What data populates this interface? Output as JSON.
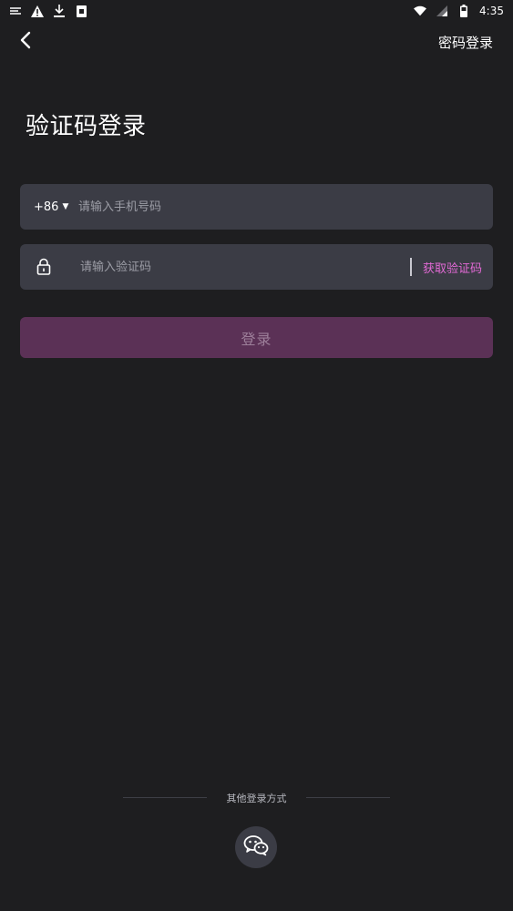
{
  "status_bar": {
    "time": "4:35",
    "left_icons": [
      "message-icon",
      "warning-icon",
      "download-icon",
      "app-notification-icon"
    ],
    "right_icons": [
      "wifi-icon",
      "signal-icon",
      "battery-icon"
    ]
  },
  "header": {
    "back_icon": "chevron-left-icon",
    "password_login_label": "密码登录"
  },
  "title": "验证码登录",
  "phone": {
    "country_code": "+86",
    "placeholder": "请输入手机号码"
  },
  "code": {
    "lock_icon": "lock-icon",
    "placeholder": "请输入验证码",
    "get_code_label": "获取验证码"
  },
  "login_button_label": "登录",
  "other_login": {
    "label": "其他登录方式",
    "wechat_icon": "wechat-icon"
  },
  "colors": {
    "background": "#1e1e20",
    "field_background": "#3b3c45",
    "accent": "#e36ad6",
    "login_button": "#5b3156"
  }
}
